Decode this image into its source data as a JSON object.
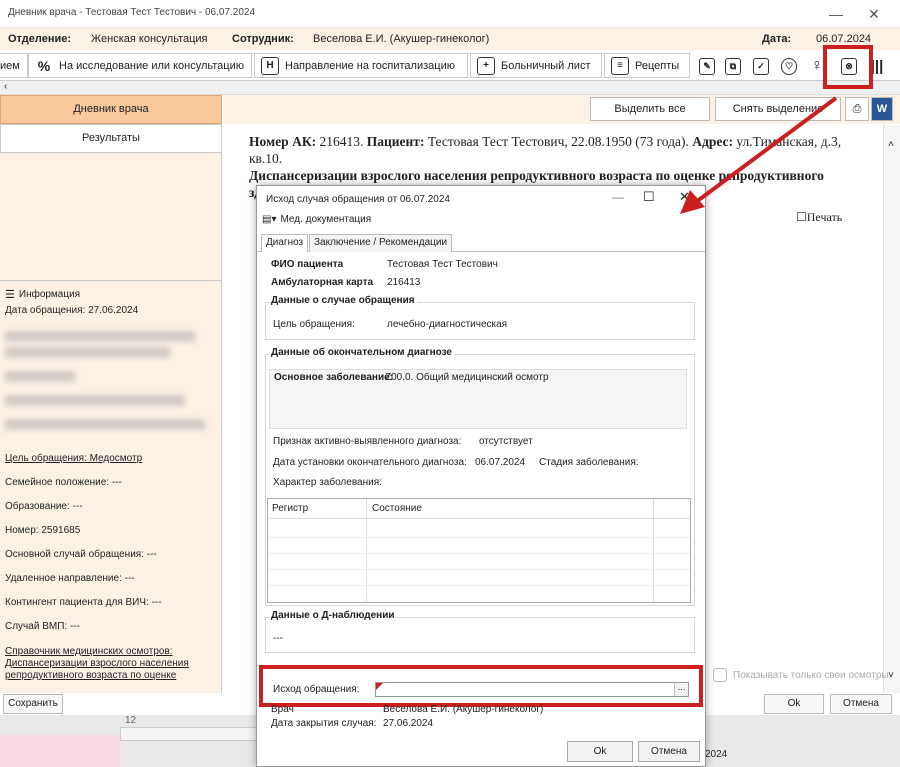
{
  "window": {
    "title": "Дневник врача - Тестовая Тест Тестович - 06.07.2024",
    "minimize": "—",
    "maximize": "☐",
    "close": "✕"
  },
  "info_bar": {
    "dept_label": "Отделение:",
    "dept_value": "Женская консультация",
    "staff_label": "Сотрудник:",
    "staff_value": "Веселова Е.И. (Акушер-гинеколог)",
    "date_label": "Дата:",
    "date_value": "06.07.2024"
  },
  "toolbar": {
    "cut_tab": "ием",
    "tabs": [
      "На исследование или консультацию",
      "Направление на госпитализацию",
      "Больничный лист",
      "Рецепты"
    ],
    "icons": [
      "tb-icon-1",
      "tb-icon-2",
      "tb-icon-3",
      "tb-icon-4",
      "tb-icon-5",
      "outcome-icon",
      "books-icon"
    ]
  },
  "left_panel": {
    "btn_diary": "Дневник врача",
    "btn_results": "Результаты",
    "info_title": "Информация",
    "visit_date": "Дата обращения: 27.06.2024",
    "purpose": "Цель обращения: Медосмотр",
    "family": "Семейное положение: ---",
    "education": "Образование: ---",
    "number": "Номер: 2591685",
    "main_case": "Основной случай обращения: ---",
    "remote": "Удаленное направление: ---",
    "hiv": "Контингент пациента для ВИЧ: ---",
    "vmp": "Случай ВМП: ---",
    "ref_line1": "Справочник медицинских осмотров:",
    "ref_line2": "Диспансеризации взрослого населения",
    "ref_line3": "репродуктивного возраста по оценке"
  },
  "right": {
    "select_all": "Выделить все",
    "deselect": "Снять выделение",
    "doc_ak_label": "Номер АК:",
    "doc_ak_value": " 216413. ",
    "doc_patient_label": "Пациент:",
    "doc_patient_value": " Тестовая Тест Тестович, 22.08.1950 (73 года). ",
    "doc_addr_label": "Адрес:",
    "doc_addr_value": " ул.Тиманская, д.3, кв.10.",
    "doc_line2": "Диспансеризации взрослого населения репродуктивного возраста по оценке репродуктивного здоровья 1 этап.",
    "print_label": "Печать",
    "show_own": "Показывать только свои осмотры"
  },
  "bottom": {
    "save": "Сохранить",
    "ok": "Ok",
    "cancel": "Отмена",
    "under_num": "12",
    "under_date": "2024"
  },
  "dialog": {
    "title": "Исход случая обращения от 06.07.2024",
    "menu_docs": "Мед. документация",
    "tab_diagnosis": "Диагноз",
    "tab_conclusion": "Заключение / Рекомендации",
    "fio_label": "ФИО пациента",
    "fio_value": "Тестовая Тест Тестович",
    "card_label": "Амбулаторная карта",
    "card_value": "216413",
    "case_group": "Данные о случае обращения",
    "purpose_label": "Цель обращения:",
    "purpose_value": "лечебно-диагностическая",
    "diag_group": "Данные об окончательном диагнозе",
    "main_disease_label": "Основное заболевание:",
    "main_disease_value": " Z00.0. Общий медицинский осмотр",
    "active_label": "Признак активно-выявленного диагноза:",
    "active_value": "отсутствует",
    "diag_date_label": "Дата установки окончательного диагноза:",
    "diag_date_value": "06.07.2024",
    "stage_label": "Стадия заболевания:",
    "character_label": "Характер заболевания:",
    "col_register": "Регистр",
    "col_state": "Состояние",
    "d_group": "Данные о Д-наблюдении",
    "d_value": "---",
    "outcome_label": "Исход обращения:",
    "doctor_label": "Врач",
    "doctor_value": "Веселова Е.И. (Акушер-гинеколог)",
    "close_date_label": "Дата закрытия случая:",
    "close_date_value": "27.06.2024",
    "ok": "Ok",
    "cancel": "Отмена"
  },
  "colors": {
    "highlight": "#cc1f1f",
    "left_bg": "#fdf1e6",
    "active_btn": "#f9c89b"
  }
}
